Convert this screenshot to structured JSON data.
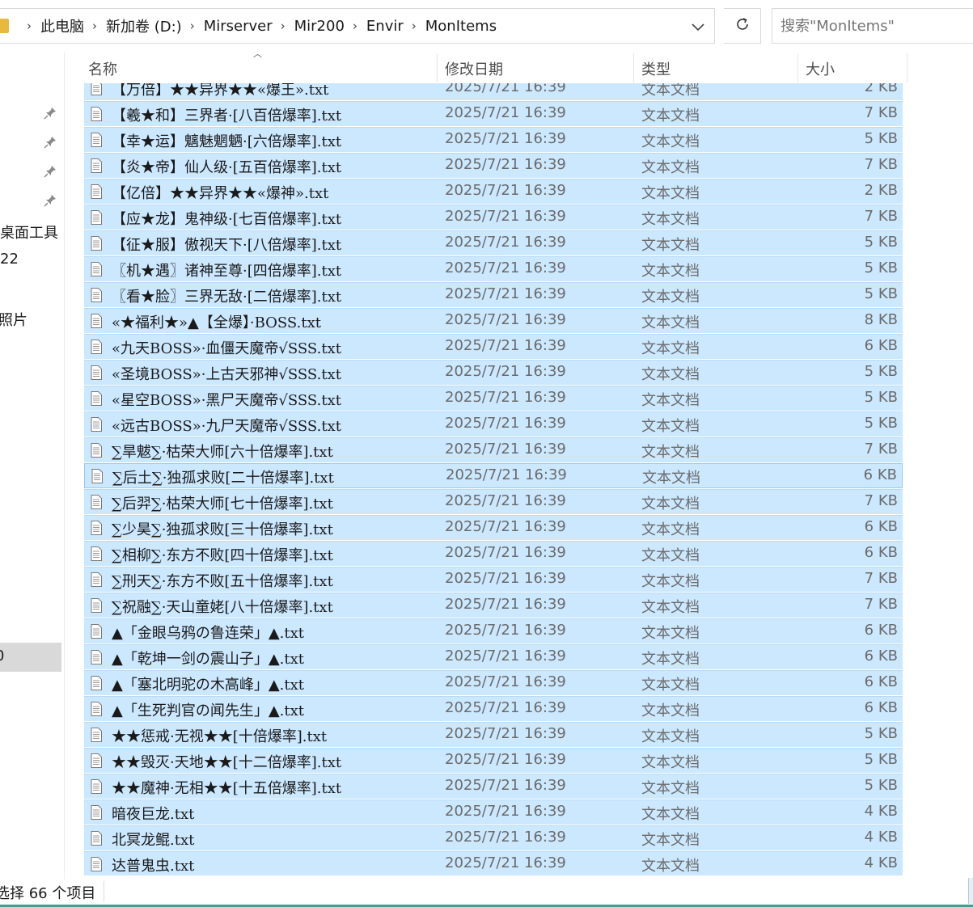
{
  "breadcrumb": [
    "此电脑",
    "新加卷 (D:)",
    "Mirserver",
    "Mir200",
    "Envir",
    "MonItems"
  ],
  "search": {
    "placeholder": "搜索\"MonItems\""
  },
  "nav": {
    "items": [
      "桌面工具",
      "22",
      "照片"
    ],
    "selected_item": "0"
  },
  "columns": {
    "name": "名称",
    "date": "修改日期",
    "type": "类型",
    "size": "大小"
  },
  "files": [
    {
      "name": "【万倍】★★异界★★«爆王».txt",
      "date": "2025/7/21 16:39",
      "type": "文本文档",
      "size": "2 KB"
    },
    {
      "name": "【羲★和】三界者·[八百倍爆率].txt",
      "date": "2025/7/21 16:39",
      "type": "文本文档",
      "size": "7 KB"
    },
    {
      "name": "【幸★运】魑魅魍魉·[六倍爆率].txt",
      "date": "2025/7/21 16:39",
      "type": "文本文档",
      "size": "5 KB"
    },
    {
      "name": "【炎★帝】仙人级·[五百倍爆率].txt",
      "date": "2025/7/21 16:39",
      "type": "文本文档",
      "size": "7 KB"
    },
    {
      "name": "【亿倍】★★异界★★«爆神».txt",
      "date": "2025/7/21 16:39",
      "type": "文本文档",
      "size": "2 KB"
    },
    {
      "name": "【应★龙】鬼神级·[七百倍爆率].txt",
      "date": "2025/7/21 16:39",
      "type": "文本文档",
      "size": "7 KB"
    },
    {
      "name": "【征★服】傲视天下·[八倍爆率].txt",
      "date": "2025/7/21 16:39",
      "type": "文本文档",
      "size": "5 KB"
    },
    {
      "name": "〖机★遇〗诸神至尊·[四倍爆率].txt",
      "date": "2025/7/21 16:39",
      "type": "文本文档",
      "size": "5 KB"
    },
    {
      "name": "〖看★脸〗三界无敌·[二倍爆率].txt",
      "date": "2025/7/21 16:39",
      "type": "文本文档",
      "size": "5 KB"
    },
    {
      "name": "«★福利★»▲【全爆】·BOSS.txt",
      "date": "2025/7/21 16:39",
      "type": "文本文档",
      "size": "8 KB"
    },
    {
      "name": "«九天BOSS»·血僵天魔帝√SSS.txt",
      "date": "2025/7/21 16:39",
      "type": "文本文档",
      "size": "6 KB"
    },
    {
      "name": "«圣境BOSS»·上古天邪神√SSS.txt",
      "date": "2025/7/21 16:39",
      "type": "文本文档",
      "size": "5 KB"
    },
    {
      "name": "«星空BOSS»·黑尸天魔帝√SSS.txt",
      "date": "2025/7/21 16:39",
      "type": "文本文档",
      "size": "5 KB"
    },
    {
      "name": "«远古BOSS»·九尸天魔帝√SSS.txt",
      "date": "2025/7/21 16:39",
      "type": "文本文档",
      "size": "5 KB"
    },
    {
      "name": "∑旱魃∑·枯荣大师[六十倍爆率].txt",
      "date": "2025/7/21 16:39",
      "type": "文本文档",
      "size": "7 KB"
    },
    {
      "name": "∑后土∑·独孤求败[二十倍爆率].txt",
      "date": "2025/7/21 16:39",
      "type": "文本文档",
      "size": "6 KB"
    },
    {
      "name": "∑后羿∑·枯荣大师[七十倍爆率].txt",
      "date": "2025/7/21 16:39",
      "type": "文本文档",
      "size": "7 KB"
    },
    {
      "name": "∑少昊∑·独孤求败[三十倍爆率].txt",
      "date": "2025/7/21 16:39",
      "type": "文本文档",
      "size": "6 KB"
    },
    {
      "name": "∑相柳∑·东方不败[四十倍爆率].txt",
      "date": "2025/7/21 16:39",
      "type": "文本文档",
      "size": "6 KB"
    },
    {
      "name": "∑刑天∑·东方不败[五十倍爆率].txt",
      "date": "2025/7/21 16:39",
      "type": "文本文档",
      "size": "7 KB"
    },
    {
      "name": "∑祝融∑·天山童姥[八十倍爆率].txt",
      "date": "2025/7/21 16:39",
      "type": "文本文档",
      "size": "7 KB"
    },
    {
      "name": "▲「金眼乌鸦の鲁连荣」▲.txt",
      "date": "2025/7/21 16:39",
      "type": "文本文档",
      "size": "6 KB"
    },
    {
      "name": "▲「乾坤一剑の震山子」▲.txt",
      "date": "2025/7/21 16:39",
      "type": "文本文档",
      "size": "6 KB"
    },
    {
      "name": "▲「塞北明驼の木高峰」▲.txt",
      "date": "2025/7/21 16:39",
      "type": "文本文档",
      "size": "6 KB"
    },
    {
      "name": "▲「生死判官の闻先生」▲.txt",
      "date": "2025/7/21 16:39",
      "type": "文本文档",
      "size": "6 KB"
    },
    {
      "name": "★★惩戒·无视★★[十倍爆率].txt",
      "date": "2025/7/21 16:39",
      "type": "文本文档",
      "size": "5 KB"
    },
    {
      "name": "★★毁灭·天地★★[十二倍爆率].txt",
      "date": "2025/7/21 16:39",
      "type": "文本文档",
      "size": "5 KB"
    },
    {
      "name": "★★魔神·无相★★[十五倍爆率].txt",
      "date": "2025/7/21 16:39",
      "type": "文本文档",
      "size": "5 KB"
    },
    {
      "name": "暗夜巨龙.txt",
      "date": "2025/7/21 16:39",
      "type": "文本文档",
      "size": "4 KB"
    },
    {
      "name": "北冥龙鲲.txt",
      "date": "2025/7/21 16:39",
      "type": "文本文档",
      "size": "4 KB"
    },
    {
      "name": "达普鬼虫.txt",
      "date": "2025/7/21 16:39",
      "type": "文本文档",
      "size": "4 KB"
    }
  ],
  "status": {
    "text": "选择 66 个项目"
  },
  "colors": {
    "selection": "#cce8ff",
    "selection_border": "#99c9ef"
  }
}
